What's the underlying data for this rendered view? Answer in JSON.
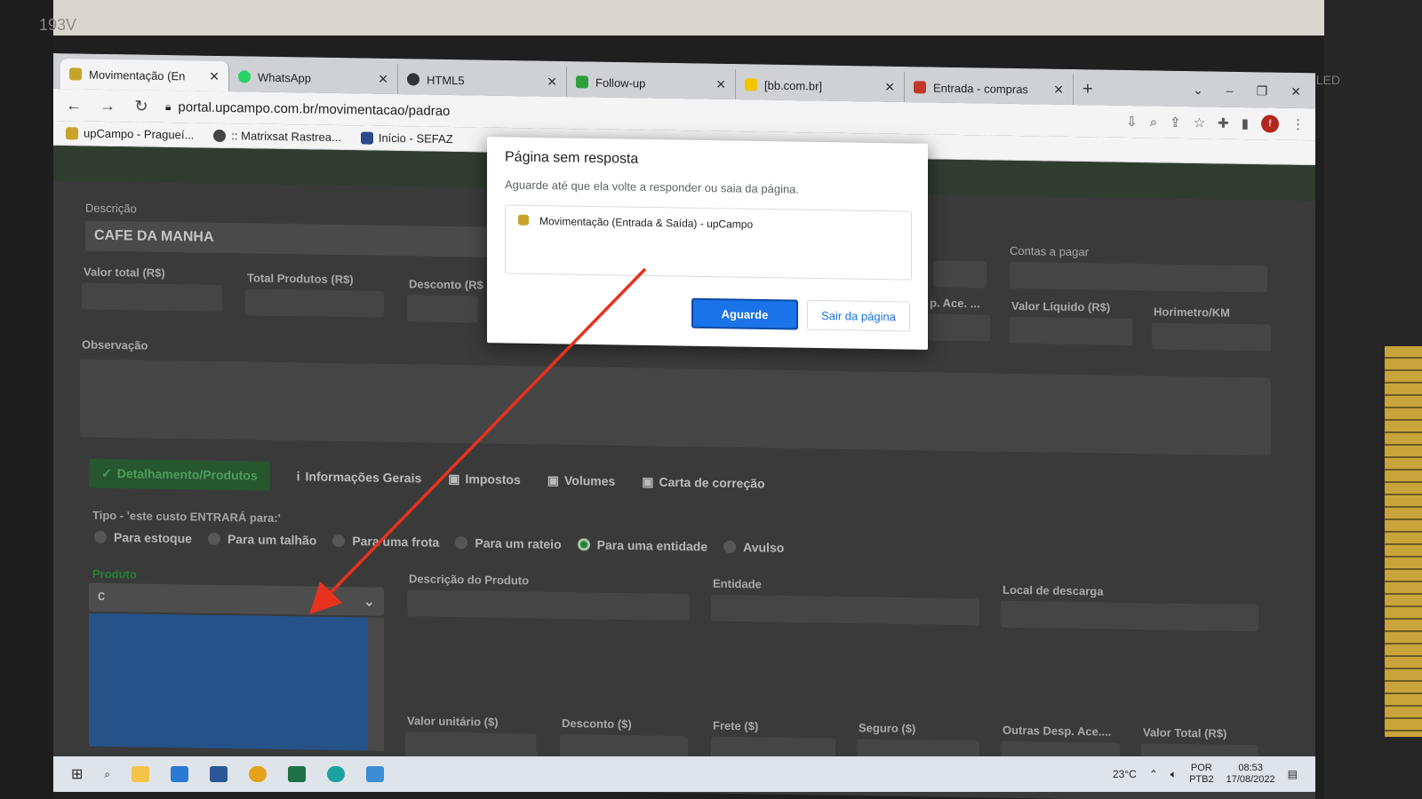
{
  "monitor": {
    "label": "193V",
    "led": "LED"
  },
  "browser": {
    "tabs": [
      {
        "title": "Movimentação (En",
        "color": "#c7a32b",
        "active": true
      },
      {
        "title": "WhatsApp",
        "color": "#25d366",
        "active": false
      },
      {
        "title": "HTML5",
        "color": "#333333",
        "active": false
      },
      {
        "title": "Follow-up",
        "color": "#2e9e3f",
        "active": false
      },
      {
        "title": "[bb.com.br]",
        "color": "#f2c500",
        "active": false
      },
      {
        "title": "Entrada - compras",
        "color": "#c0392b",
        "active": false
      }
    ],
    "new_tab": "+",
    "url": "portal.upcampo.com.br/movimentacao/padrao",
    "bookmarks": [
      {
        "label": "upCampo - Pragueí..."
      },
      {
        "label": ":: Matrixsat Rastrea..."
      },
      {
        "label": "Início - SEFAZ"
      }
    ],
    "window_controls": [
      "⌄",
      "–",
      "❐",
      "✕"
    ]
  },
  "form": {
    "descricao_label": "Descrição",
    "descricao_value": "CAFE DA MANHA",
    "contas_label": "Contas a pagar",
    "valor_total_label": "Valor total (R$)",
    "total_produtos_label": "Total Produtos (R$)",
    "desconto_label": "Desconto (R$",
    "ace_label": "p. Ace. ...",
    "valor_liquido_label": "Valor Líquido (R$)",
    "horimetro_label": "Horimetro/KM",
    "observacao_label": "Observação",
    "section_tabs": [
      {
        "label": "Detalhamento/Produtos",
        "icon": "✓",
        "active": true
      },
      {
        "label": "Informações Gerais",
        "icon": "i",
        "active": false
      },
      {
        "label": "Impostos",
        "icon": "▣",
        "active": false
      },
      {
        "label": "Volumes",
        "icon": "▣",
        "active": false
      },
      {
        "label": "Carta de correção",
        "icon": "▣",
        "active": false
      }
    ],
    "tipo_label": "Tipo - 'este custo ENTRARÁ para:'",
    "tipo_options": [
      {
        "label": "Para estoque",
        "checked": false
      },
      {
        "label": "Para um talhão",
        "checked": false
      },
      {
        "label": "Para uma frota",
        "checked": false
      },
      {
        "label": "Para um rateio",
        "checked": false
      },
      {
        "label": "Para uma entidade",
        "checked": true
      },
      {
        "label": "Avulso",
        "checked": false
      }
    ],
    "produto_label": "Produto",
    "produto_value": "c",
    "descricao_produto_label": "Descrição do Produto",
    "entidade_label": "Entidade",
    "local_label": "Local de descarga",
    "valor_unitario_label": "Valor unitário ($)",
    "desconto2_label": "Desconto ($)",
    "frete_label": "Frete ($)",
    "seguro_label": "Seguro ($)",
    "outras_label": "Outras Desp. Ace....",
    "valor_total2_label": "Valor Total (R$)"
  },
  "dialog": {
    "title": "Página sem resposta",
    "message": "Aguarde até que ela volte a responder ou saia da página.",
    "page_name": "Movimentação (Entrada & Saída) - upCampo",
    "wait_button": "Aguarde",
    "leave_button": "Sair da página"
  },
  "taskbar": {
    "temperature": "23°C",
    "language": "POR",
    "layout": "PTB2",
    "time": "08:53",
    "date": "17/08/2022"
  },
  "colors": {
    "accent": "#1a73e8",
    "annotation": "#e8321e",
    "dropdown": "#2d64a8",
    "active_tab": "#2e9e3f"
  }
}
